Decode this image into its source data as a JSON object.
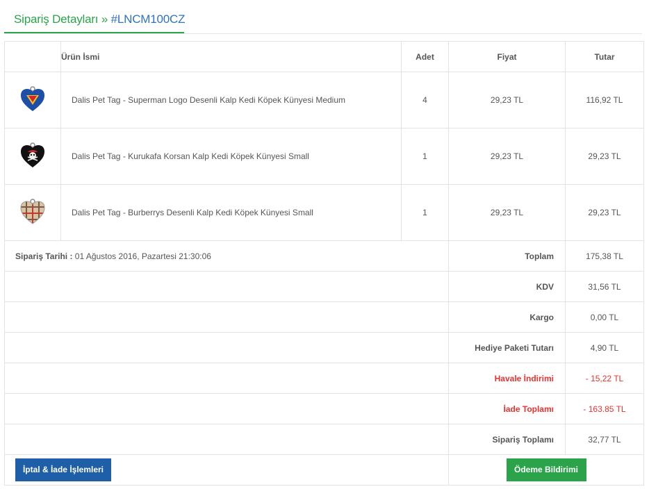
{
  "header": {
    "title": "Sipariş Detayları » ",
    "order_no": "#LNCM100CZ"
  },
  "table": {
    "columns": {
      "name": "Ürün İsmi",
      "qty": "Adet",
      "price": "Fiyat",
      "total": "Tutar"
    },
    "items": [
      {
        "name": "Dalis Pet Tag - Superman Logo Desenli Kalp Kedi Köpek Künyesi Medium",
        "qty": "4",
        "price": "29,23 TL",
        "total": "116,92 TL",
        "icon": "superman-heart-tag-icon"
      },
      {
        "name": "Dalis Pet Tag - Kurukafa Korsan Kalp Kedi Köpek Künyesi Small",
        "qty": "1",
        "price": "29,23 TL",
        "total": "29,23 TL",
        "icon": "skull-heart-tag-icon"
      },
      {
        "name": "Dalis Pet Tag - Burberrys Desenli Kalp Kedi Köpek Künyesi Small",
        "qty": "1",
        "price": "29,23 TL",
        "total": "29,23 TL",
        "icon": "plaid-heart-tag-icon"
      }
    ]
  },
  "order_date": {
    "label": "Sipariş Tarihi :",
    "value": " 01 Ağustos 2016, Pazartesi 21:30:06"
  },
  "summary": {
    "toplam_label": "Toplam",
    "toplam": "175,38 TL",
    "kdv_label": "KDV",
    "kdv": "31,56 TL",
    "kargo_label": "Kargo",
    "kargo": "0,00 TL",
    "hediye_label": "Hediye Paketi Tutarı",
    "hediye": "4,90 TL",
    "havale_label": "Havale İndirimi",
    "havale": "- 15,22 TL",
    "iade_label": "İade Toplamı",
    "iade": "- 163.85 TL",
    "siparis_toplami_label": "Sipariş Toplamı",
    "siparis_toplami": "32,77 TL"
  },
  "buttons": {
    "iptal_iade": "İptal & İade İşlemleri",
    "odeme_bildirimi": "Ödeme Bildirimi"
  },
  "colors": {
    "accent_green": "#2aa34a",
    "link_blue": "#2f72c6",
    "button_blue": "#1f5fa8",
    "discount_red": "#e8322f"
  }
}
